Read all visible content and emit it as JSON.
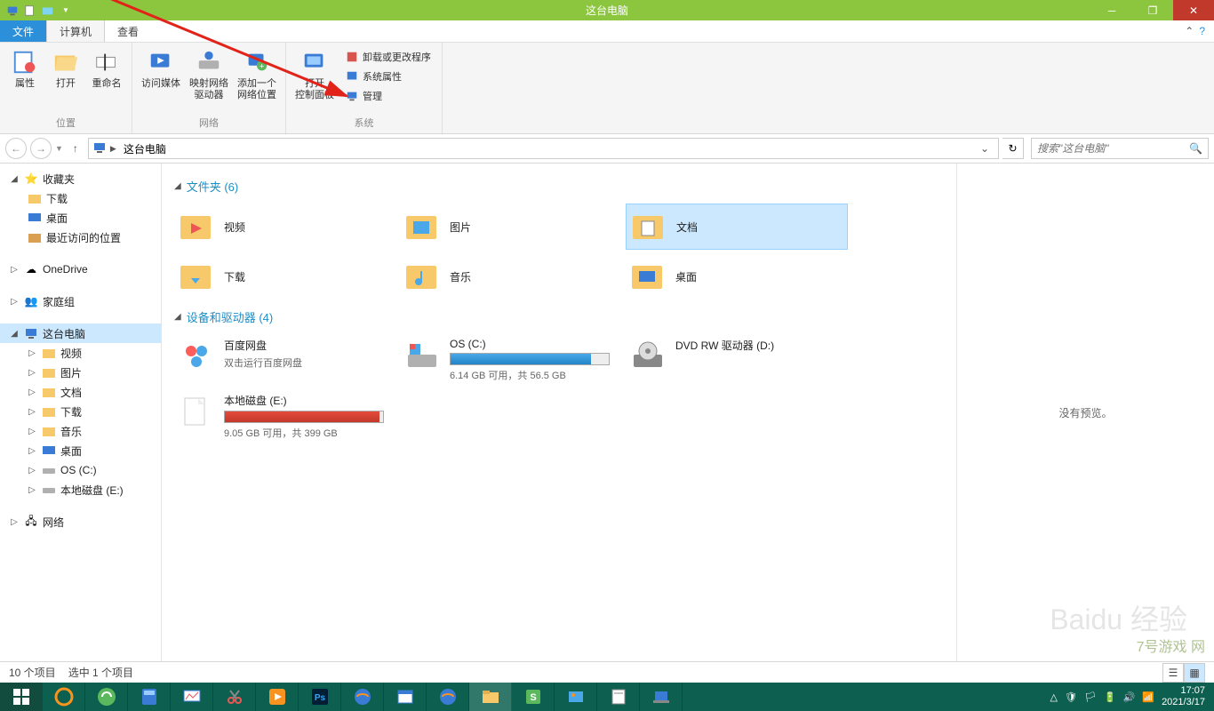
{
  "title": "这台电脑",
  "tabs": {
    "file": "文件",
    "computer": "计算机",
    "view": "查看"
  },
  "ribbon": {
    "group1": {
      "label": "位置",
      "properties": "属性",
      "open": "打开",
      "rename": "重命名"
    },
    "group2": {
      "label": "网络",
      "accessMedia": "访问媒体",
      "mapDrive": "映射网络\n驱动器",
      "addLocation": "添加一个\n网络位置"
    },
    "group3": {
      "label": "系统",
      "controlPanel": "打开\n控制面板",
      "uninstall": "卸载或更改程序",
      "sysProps": "系统属性",
      "manage": "管理"
    }
  },
  "breadcrumb": "这台电脑",
  "searchPlaceholder": "搜索\"这台电脑\"",
  "sidebar": {
    "favorites": "收藏夹",
    "downloads": "下载",
    "desktop": "桌面",
    "recent": "最近访问的位置",
    "onedrive": "OneDrive",
    "homegroup": "家庭组",
    "thispc": "这台电脑",
    "video": "视频",
    "pictures": "图片",
    "documents": "文档",
    "downloads2": "下载",
    "music": "音乐",
    "desktop2": "桌面",
    "osc": "OS (C:)",
    "locale": "本地磁盘 (E:)",
    "network": "网络"
  },
  "sections": {
    "folders": "文件夹 (6)",
    "devices": "设备和驱动器 (4)"
  },
  "folders": {
    "video": "视频",
    "pictures": "图片",
    "documents": "文档",
    "downloads": "下载",
    "music": "音乐",
    "desktop": "桌面"
  },
  "drives": {
    "baidu": {
      "name": "百度网盘",
      "subtitle": "双击运行百度网盘"
    },
    "osc": {
      "name": "OS (C:)",
      "stats": "6.14 GB 可用，共 56.5 GB"
    },
    "dvd": {
      "name": "DVD RW 驱动器 (D:)"
    },
    "locale": {
      "name": "本地磁盘 (E:)",
      "stats": "9.05 GB 可用，共 399 GB"
    }
  },
  "preview": "没有预览。",
  "status": {
    "count": "10 个项目",
    "selected": "选中 1 个项目"
  },
  "taskbar": {
    "time": "17:07",
    "date": "2021/3/17"
  }
}
